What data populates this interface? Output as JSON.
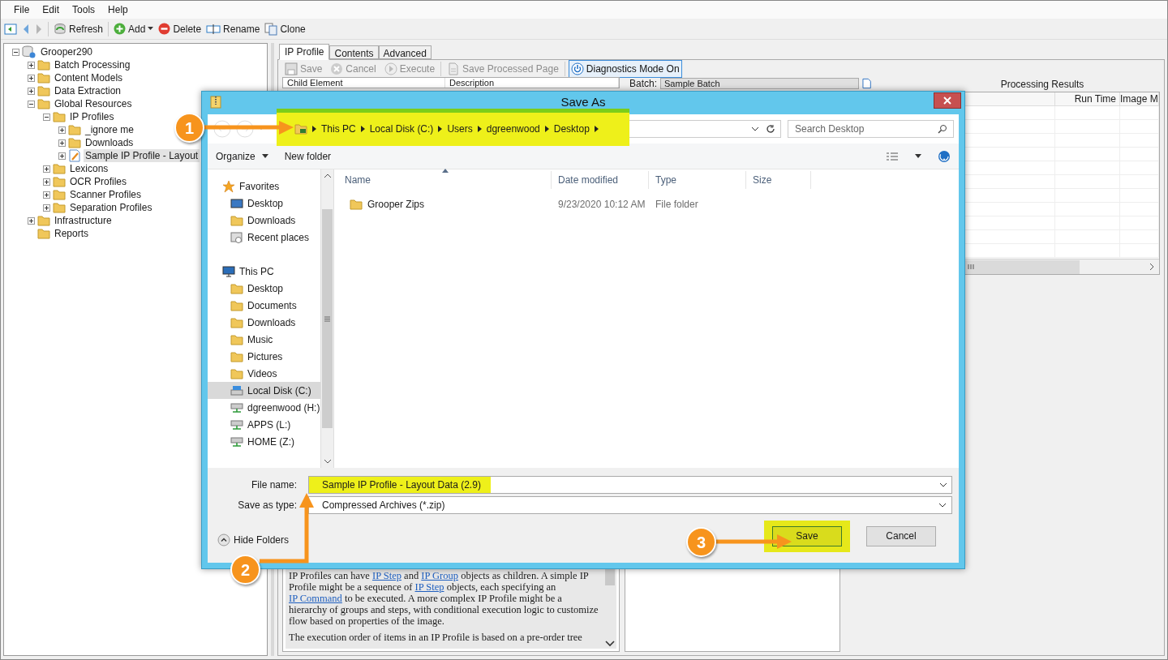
{
  "menu": [
    "File",
    "Edit",
    "Tools",
    "Help"
  ],
  "toolbar": [
    {
      "kind": "home"
    },
    {
      "kind": "back"
    },
    {
      "kind": "forward"
    },
    {
      "kind": "refresh",
      "label": "Refresh"
    },
    {
      "kind": "add",
      "label": "Add"
    },
    {
      "kind": "delete",
      "label": "Delete"
    },
    {
      "kind": "rename",
      "label": "Rename"
    },
    {
      "kind": "clone",
      "label": "Clone"
    }
  ],
  "tree": [
    {
      "label": "Grooper290",
      "kind": "server",
      "expandable": true,
      "expanded": true,
      "selected": false,
      "children": [
        {
          "label": "Batch Processing",
          "kind": "folder",
          "expandable": true,
          "expanded": false,
          "selected": false
        },
        {
          "label": "Content Models",
          "kind": "folder",
          "expandable": true,
          "expanded": false,
          "selected": false
        },
        {
          "label": "Data Extraction",
          "kind": "folder",
          "expandable": true,
          "expanded": false,
          "selected": false
        },
        {
          "label": "Global Resources",
          "kind": "folder",
          "expandable": true,
          "expanded": true,
          "selected": false,
          "children": [
            {
              "label": "IP Profiles",
              "kind": "folder",
              "expandable": true,
              "expanded": true,
              "selected": false,
              "children": [
                {
                  "label": "_ignore me",
                  "kind": "folder",
                  "expandable": true,
                  "expanded": false,
                  "selected": false
                },
                {
                  "label": "Downloads",
                  "kind": "folder",
                  "expandable": true,
                  "expanded": false,
                  "selected": false
                },
                {
                  "label": "Sample IP Profile - Layout",
                  "kind": "document",
                  "expandable": true,
                  "expanded": false,
                  "selected": true
                }
              ]
            },
            {
              "label": "Lexicons",
              "kind": "folder",
              "expandable": true,
              "expanded": false,
              "selected": false
            },
            {
              "label": "OCR Profiles",
              "kind": "folder",
              "expandable": true,
              "expanded": false,
              "selected": false
            },
            {
              "label": "Scanner Profiles",
              "kind": "folder",
              "expandable": true,
              "expanded": false,
              "selected": false
            },
            {
              "label": "Separation Profiles",
              "kind": "folder",
              "expandable": true,
              "expanded": false,
              "selected": false
            }
          ]
        },
        {
          "label": "Infrastructure",
          "kind": "folder",
          "expandable": true,
          "expanded": false,
          "selected": false
        },
        {
          "label": "Reports",
          "kind": "folder",
          "expandable": false,
          "selected": false
        }
      ]
    }
  ],
  "tabs": [
    {
      "label": "IP Profile",
      "selected": true
    },
    {
      "label": "Contents",
      "selected": false
    },
    {
      "label": "Advanced",
      "selected": false
    }
  ],
  "profile_toolbar": [
    {
      "kind": "save",
      "label": "Save",
      "disabled": true,
      "on": false
    },
    {
      "kind": "cancel",
      "label": "Cancel",
      "disabled": true,
      "on": false
    },
    {
      "kind": "execute",
      "label": "Execute",
      "disabled": true,
      "on": false
    },
    {
      "kind": "save-page",
      "label": "Save Processed Page",
      "disabled": true,
      "on": false
    },
    {
      "kind": "power",
      "label": "Diagnostics Mode On",
      "disabled": false,
      "on": true
    }
  ],
  "child_grid": {
    "columns": [
      "Child Element",
      "Description"
    ]
  },
  "batch": {
    "label": "Batch:",
    "value": "Sample Batch"
  },
  "processing_results": {
    "title": "Processing Results",
    "columns": [
      "Run Time",
      "Image M"
    ]
  },
  "help_text": [
    [
      {
        "text": "IP Profiles can have "
      },
      {
        "text": "IP Step",
        "link": true
      },
      {
        "text": " and "
      },
      {
        "text": "IP Group",
        "link": true
      },
      {
        "text": " objects as children. A simple IP Profile might be a sequence of "
      },
      {
        "text": "IP Step",
        "link": true
      },
      {
        "text": " objects, each specifying an "
      },
      {
        "text": "IP Command",
        "link": true
      },
      {
        "text": " to be executed. A more complex IP Profile might be a hierarchy of groups and steps, with conditional execution logic to customize flow based on properties of the image."
      }
    ],
    [
      {
        "text": "The execution order of items in an IP Profile is based on a pre-order tree"
      }
    ]
  ],
  "dialog": {
    "title": "Save As",
    "address": {
      "crumbs": [
        "This PC",
        "Local Disk (C:)",
        "Users",
        "dgreenwood",
        "Desktop"
      ],
      "highlighted": true
    },
    "search": {
      "placeholder": "Search Desktop"
    },
    "commands": [
      {
        "label": "Organize",
        "dropdown": true
      },
      {
        "label": "New folder",
        "dropdown": false
      }
    ],
    "nav": [
      {
        "label": "Favorites",
        "kind": "star",
        "items": [
          {
            "label": "Desktop",
            "kind": "desktop",
            "selected": false
          },
          {
            "label": "Downloads",
            "kind": "folder",
            "selected": false
          },
          {
            "label": "Recent places",
            "kind": "recent",
            "selected": false
          }
        ]
      },
      {
        "label": "This PC",
        "kind": "pc",
        "items": [
          {
            "label": "Desktop",
            "kind": "folder",
            "selected": false
          },
          {
            "label": "Documents",
            "kind": "folder",
            "selected": false
          },
          {
            "label": "Downloads",
            "kind": "folder",
            "selected": false
          },
          {
            "label": "Music",
            "kind": "folder",
            "selected": false
          },
          {
            "label": "Pictures",
            "kind": "folder",
            "selected": false
          },
          {
            "label": "Videos",
            "kind": "folder",
            "selected": false
          },
          {
            "label": "Local Disk (C:)",
            "kind": "disk",
            "selected": true
          },
          {
            "label": "dgreenwood (H:)",
            "kind": "network",
            "selected": false
          },
          {
            "label": "APPS (L:)",
            "kind": "network",
            "selected": false
          },
          {
            "label": "HOME (Z:)",
            "kind": "network",
            "selected": false
          }
        ]
      }
    ],
    "columns": [
      {
        "label": "Name",
        "sorted": true
      },
      {
        "label": "Date modified",
        "sorted": false
      },
      {
        "label": "Type",
        "sorted": false
      },
      {
        "label": "Size",
        "sorted": false
      }
    ],
    "files": [
      {
        "name": "Grooper Zips",
        "date": "9/23/2020 10:12 AM",
        "type": "File folder"
      }
    ],
    "file_name": {
      "label": "File name:",
      "value": "Sample IP Profile - Layout Data (2.9)",
      "highlighted": true
    },
    "save_as_type": {
      "label": "Save as type:",
      "value": "Compressed Archives (*.zip)"
    },
    "hide_folders": "Hide Folders",
    "buttons": [
      {
        "label": "Save",
        "default": true,
        "highlighted": true
      },
      {
        "label": "Cancel",
        "default": false,
        "highlighted": false
      }
    ]
  },
  "callouts": [
    {
      "number": "1"
    },
    {
      "number": "2"
    },
    {
      "number": "3"
    }
  ]
}
